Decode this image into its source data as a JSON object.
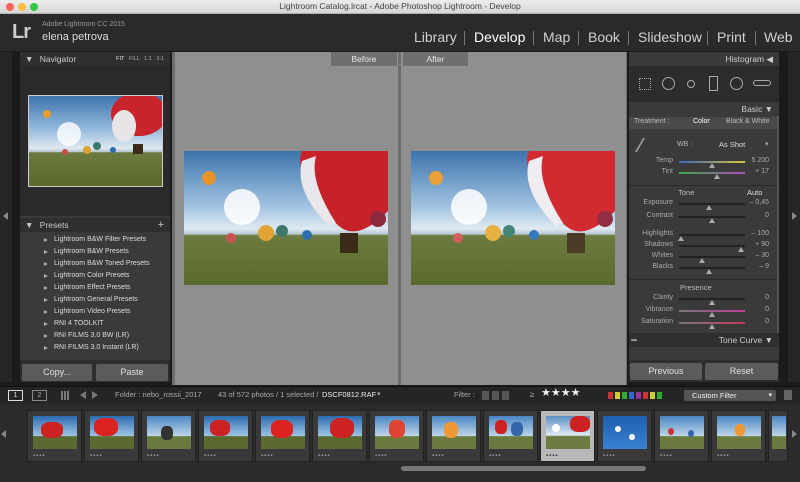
{
  "window": {
    "title": "Lightroom Catalog.lrcat - Adobe Photoshop Lightroom - Develop"
  },
  "identity": {
    "logo": "Lr",
    "product": "Adobe Lightroom CC 2015",
    "user": "elena petrova"
  },
  "modules": [
    "Library",
    "Develop",
    "Map",
    "Book",
    "Slideshow",
    "Print",
    "Web"
  ],
  "active_module": "Develop",
  "navigator": {
    "title": "Navigator",
    "zoom": [
      "FIT",
      "FILL",
      "1:1",
      "3:1"
    ]
  },
  "presets": {
    "title": "Presets",
    "add": "+",
    "items": [
      "Lightroom B&W Filter Presets",
      "Lightroom B&W Presets",
      "Lightroom B&W Toned Presets",
      "Lightroom Color Presets",
      "Lightroom Effect Presets",
      "Lightroom General Presets",
      "Lightroom Video Presets",
      "RNI 4 TOOLKIT",
      "RNI FILMS 3.0 BW (LR)",
      "RNI FILMS 3.0 Instant (LR)"
    ]
  },
  "left_buttons": {
    "copy": "Copy...",
    "paste": "Paste"
  },
  "view": {
    "before": "Before",
    "after": "After"
  },
  "histogram": {
    "title": "Histogram"
  },
  "basic": {
    "title": "Basic",
    "treatment_label": "Treatment :",
    "treatment_color": "Color",
    "treatment_bw": "Black & White",
    "wb_label": "WB :",
    "wb_value": "As Shot",
    "temp": {
      "label": "Temp",
      "value": "5 200"
    },
    "tint": {
      "label": "Tint",
      "value": "+ 17"
    },
    "tone_label": "Tone",
    "auto": "Auto",
    "tone": [
      {
        "label": "Exposure",
        "value": "– 0,45"
      },
      {
        "label": "Contrast",
        "value": "0"
      }
    ],
    "tone2": [
      {
        "label": "Highlights",
        "value": "– 100"
      },
      {
        "label": "Shadows",
        "value": "+ 90"
      },
      {
        "label": "Whites",
        "value": "– 30"
      },
      {
        "label": "Blacks",
        "value": "– 9"
      }
    ],
    "presence_label": "Presence",
    "presence": [
      {
        "label": "Clarity",
        "value": "0"
      },
      {
        "label": "Vibrance",
        "value": "0"
      },
      {
        "label": "Saturation",
        "value": "0"
      }
    ]
  },
  "tone_curve": {
    "title": "Tone Curve"
  },
  "right_buttons": {
    "previous": "Previous",
    "reset": "Reset"
  },
  "filmstrip": {
    "pages": [
      "1",
      "2"
    ],
    "folder": "Folder : nebo_rossii_2017",
    "count": "43 of 572 photos / 1 selected /",
    "selected_file": "DSCF0812.RAF",
    "filter_label": "Filter :",
    "rating_op": "≥",
    "stars": "★★★★",
    "filter_preset": "Custom Filter",
    "thumb_dots": "▪▪▪▪"
  }
}
